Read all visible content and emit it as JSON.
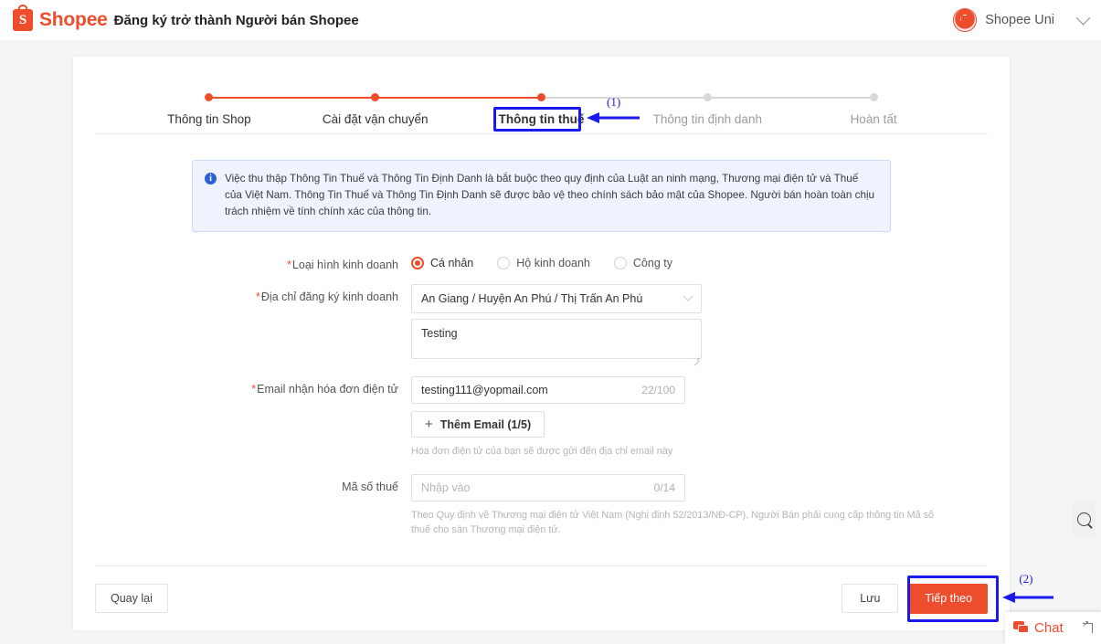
{
  "topbar": {
    "brand": "Shopee",
    "title": "Đăng ký trở thành Người bán Shopee",
    "account_name": "Shopee Uni",
    "brand_color": "#ee4d2d"
  },
  "stepper": {
    "steps": [
      {
        "label": "Thông tin Shop",
        "state": "done"
      },
      {
        "label": "Cài đặt vận chuyển",
        "state": "done"
      },
      {
        "label": "Thông tin thuế",
        "state": "current"
      },
      {
        "label": "Thông tin định danh",
        "state": "todo"
      },
      {
        "label": "Hoàn tất",
        "state": "todo"
      }
    ]
  },
  "annotations": [
    {
      "id": "1",
      "label": "(1)",
      "color": "#1a1aee",
      "target": "Thông tin thuế"
    },
    {
      "id": "2",
      "label": "(2)",
      "color": "#1a1aee",
      "target": "Tiếp theo"
    }
  ],
  "banner": {
    "icon": "info-icon",
    "text": "Việc thu thập Thông Tin Thuế và Thông Tin Định Danh là bắt buộc theo quy định của Luật an ninh mạng, Thương mại điện tử và Thuế của Việt Nam. Thông Tin Thuế và Thông Tin Định Danh sẽ được bảo vệ theo chính sách bảo mật của Shopee. Người bán hoàn toàn chịu trách nhiệm về tính chính xác của thông tin."
  },
  "form": {
    "business_type": {
      "label": "Loại hình kinh doanh",
      "required": true,
      "options": [
        "Cá nhân",
        "Hộ kinh doanh",
        "Công ty"
      ],
      "selected": "Cá nhân"
    },
    "address": {
      "label": "Địa chỉ đăng ký kinh doanh",
      "required": true,
      "value": "An Giang / Huyện An Phú / Thị Trấn An Phú"
    },
    "address_detail": {
      "value": "Testing"
    },
    "email": {
      "label": "Email nhận hóa đơn điện tử",
      "required": true,
      "value": "testing111@yopmail.com",
      "counter": "22/100"
    },
    "add_email": {
      "label": "Thêm Email (1/5)",
      "hint": "Hóa đơn điện tử của bạn sẽ được gửi đến địa chỉ email này"
    },
    "tax_code": {
      "label": "Mã số thuế",
      "required": false,
      "placeholder": "Nhập vào",
      "counter": "0/14",
      "hint": "Theo Quy định về Thương mại điện tử Việt Nam (Nghị định 52/2013/NĐ-CP), Người Bán phải cung cấp thông tin Mã số thuế cho sàn Thương mại điện tử."
    }
  },
  "footer": {
    "back": "Quay lại",
    "save": "Lưu",
    "next": "Tiếp theo"
  },
  "widgets": {
    "chat_label": "Chat",
    "chat_icon": "chat-bubble-icon",
    "side_fab_icon": "ring-icon"
  }
}
